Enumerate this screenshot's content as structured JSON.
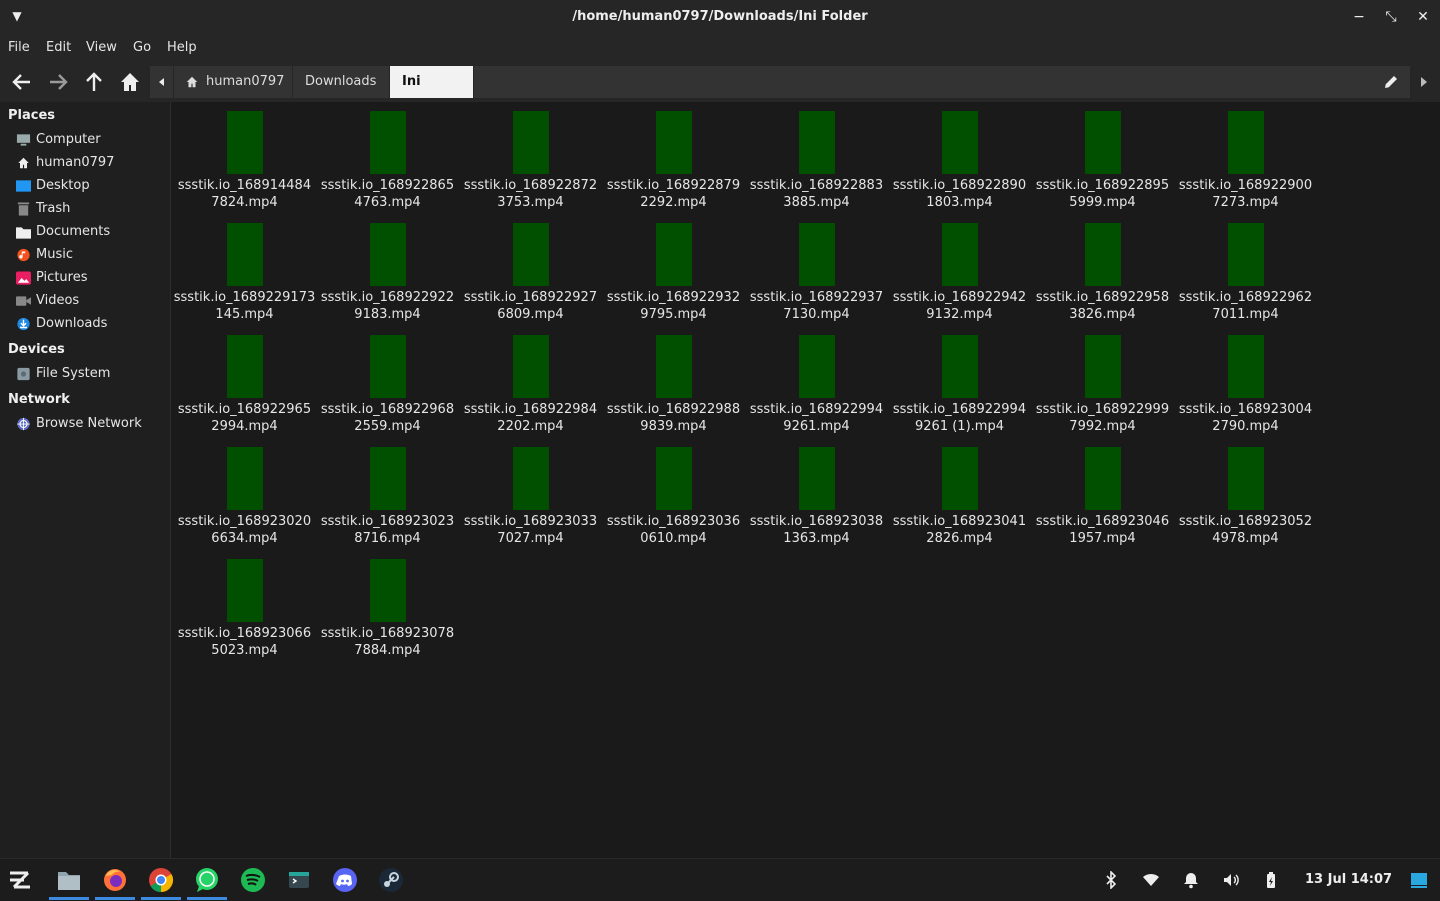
{
  "window": {
    "title": "/home/human0797/Downloads/Ini Folder"
  },
  "menubar": [
    "File",
    "Edit",
    "View",
    "Go",
    "Help"
  ],
  "pathbar": {
    "segments": [
      "human0797",
      "Downloads",
      "Ini Folder"
    ],
    "active": "Ini Folder"
  },
  "sidebar": {
    "places_header": "Places",
    "places": [
      {
        "label": "Computer",
        "icon": "computer-icon"
      },
      {
        "label": "human0797",
        "icon": "home-icon"
      },
      {
        "label": "Desktop",
        "icon": "desktop-icon"
      },
      {
        "label": "Trash",
        "icon": "trash-icon"
      },
      {
        "label": "Documents",
        "icon": "documents-icon"
      },
      {
        "label": "Music",
        "icon": "music-icon"
      },
      {
        "label": "Pictures",
        "icon": "pictures-icon"
      },
      {
        "label": "Videos",
        "icon": "videos-icon"
      },
      {
        "label": "Downloads",
        "icon": "downloads-icon"
      }
    ],
    "devices_header": "Devices",
    "devices": [
      {
        "label": "File System",
        "icon": "drive-icon"
      }
    ],
    "network_header": "Network",
    "network": [
      {
        "label": "Browse Network",
        "icon": "network-icon"
      }
    ]
  },
  "files": [
    {
      "line1": "ssstik.io_168914484",
      "line2": "7824.mp4"
    },
    {
      "line1": "ssstik.io_168922865",
      "line2": "4763.mp4"
    },
    {
      "line1": "ssstik.io_168922872",
      "line2": "3753.mp4"
    },
    {
      "line1": "ssstik.io_168922879",
      "line2": "2292.mp4"
    },
    {
      "line1": "ssstik.io_168922883",
      "line2": "3885.mp4"
    },
    {
      "line1": "ssstik.io_168922890",
      "line2": "1803.mp4"
    },
    {
      "line1": "ssstik.io_168922895",
      "line2": "5999.mp4"
    },
    {
      "line1": "ssstik.io_168922900",
      "line2": "7273.mp4"
    },
    {
      "line1": "ssstik.io_1689229173",
      "line2": "145.mp4"
    },
    {
      "line1": "ssstik.io_168922922",
      "line2": "9183.mp4"
    },
    {
      "line1": "ssstik.io_168922927",
      "line2": "6809.mp4"
    },
    {
      "line1": "ssstik.io_168922932",
      "line2": "9795.mp4"
    },
    {
      "line1": "ssstik.io_168922937",
      "line2": "7130.mp4"
    },
    {
      "line1": "ssstik.io_168922942",
      "line2": "9132.mp4"
    },
    {
      "line1": "ssstik.io_168922958",
      "line2": "3826.mp4"
    },
    {
      "line1": "ssstik.io_168922962",
      "line2": "7011.mp4"
    },
    {
      "line1": "ssstik.io_168922965",
      "line2": "2994.mp4"
    },
    {
      "line1": "ssstik.io_168922968",
      "line2": "2559.mp4"
    },
    {
      "line1": "ssstik.io_168922984",
      "line2": "2202.mp4"
    },
    {
      "line1": "ssstik.io_168922988",
      "line2": "9839.mp4"
    },
    {
      "line1": "ssstik.io_168922994",
      "line2": "9261.mp4"
    },
    {
      "line1": "ssstik.io_168922994",
      "line2": "9261 (1).mp4"
    },
    {
      "line1": "ssstik.io_168922999",
      "line2": "7992.mp4"
    },
    {
      "line1": "ssstik.io_168923004",
      "line2": "2790.mp4"
    },
    {
      "line1": "ssstik.io_168923020",
      "line2": "6634.mp4"
    },
    {
      "line1": "ssstik.io_168923023",
      "line2": "8716.mp4"
    },
    {
      "line1": "ssstik.io_168923033",
      "line2": "7027.mp4"
    },
    {
      "line1": "ssstik.io_168923036",
      "line2": "0610.mp4"
    },
    {
      "line1": "ssstik.io_168923038",
      "line2": "1363.mp4"
    },
    {
      "line1": "ssstik.io_168923041",
      "line2": "2826.mp4"
    },
    {
      "line1": "ssstik.io_168923046",
      "line2": "1957.mp4"
    },
    {
      "line1": "ssstik.io_168923052",
      "line2": "4978.mp4"
    },
    {
      "line1": "ssstik.io_168923066",
      "line2": "5023.mp4"
    },
    {
      "line1": "ssstik.io_168923078",
      "line2": "7884.mp4"
    }
  ],
  "taskbar": {
    "apps": [
      "launcher-icon",
      "file-manager-icon",
      "firefox-icon",
      "chrome-icon",
      "whatsapp-icon",
      "spotify-icon",
      "terminal-icon",
      "discord-icon",
      "steam-icon"
    ],
    "clock": "13 Jul 14:07"
  },
  "colors": {
    "accent": "#3d8be0",
    "thumbnail": "#005000"
  }
}
